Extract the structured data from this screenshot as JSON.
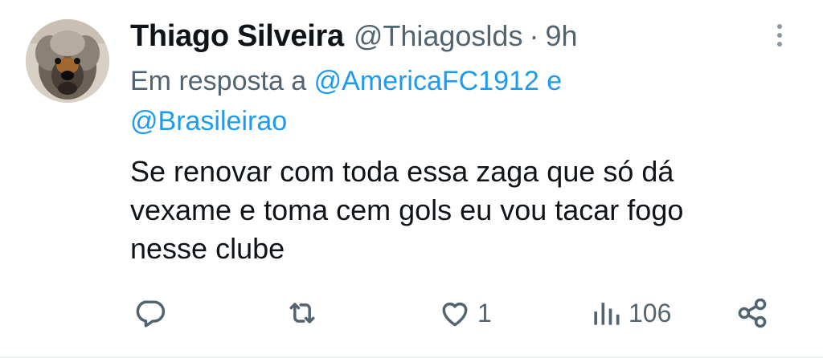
{
  "user": {
    "name": "Thiago Silveira",
    "handle": "@Thiagoslds",
    "separator": "·",
    "time": "9h"
  },
  "reply_to": {
    "prefix": "Em resposta a",
    "user1": "@AmericaFC1912",
    "conjunction": "e",
    "user2": "@Brasileirao"
  },
  "tweet": {
    "line1": "Se renovar com toda essa zaga que só dá",
    "line2": "vexame e toma cem gols eu vou tacar fogo",
    "line3": "nesse clube"
  },
  "actions": {
    "reply_icon": "comment-icon",
    "retweet_icon": "retweet-icon",
    "like_icon": "heart-icon",
    "like_count": "1",
    "views_icon": "bar-chart-icon",
    "views_count": "106",
    "share_icon": "share-icon"
  },
  "colors": {
    "link": "#1d9bf0",
    "muted": "#536471",
    "text": "#0f1419"
  }
}
